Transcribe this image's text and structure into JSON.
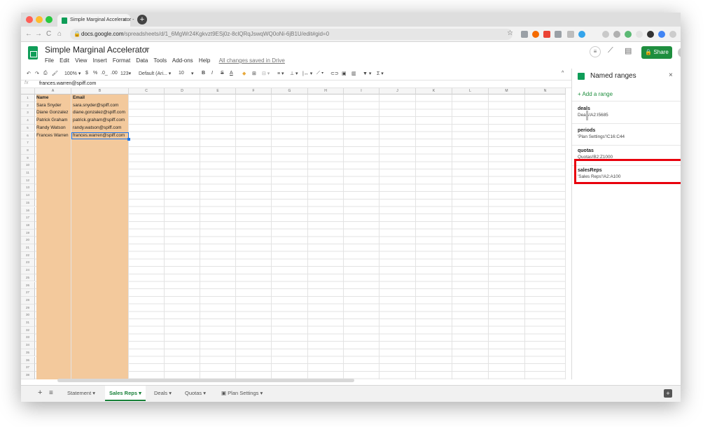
{
  "browser": {
    "tab_title": "Simple Marginal Accelerator -",
    "tab_close": "×",
    "new_tab": "+",
    "url_host": "docs.google.com",
    "url_rest": "/spreadsheets/d/1_6MgWr24Kgkvzt9ESj0z-8clQRqJswqWQ0oNi-6jB1U/edit#gid=0",
    "nav_back": "←",
    "nav_forward": "→",
    "nav_reload": "C",
    "nav_home": "⌂",
    "bookmark_star": "☆"
  },
  "doc": {
    "title": "Simple Marginal Accelerator",
    "star": "☆",
    "folder": "■",
    "menus": [
      "File",
      "Edit",
      "View",
      "Insert",
      "Format",
      "Data",
      "Tools",
      "Add-ons",
      "Help"
    ],
    "saved_status": "All changes saved in Drive",
    "share_label": "Share",
    "share_icon": "🔒"
  },
  "toolbar": {
    "undo": "↶",
    "redo": "↷",
    "print": "⎙",
    "paint": "🖌",
    "zoom": "100% ▾",
    "currency": "$",
    "percent": "%",
    "dec_less": ".0_",
    "dec_more": ".00",
    "format": "123▾",
    "font": "Default (Ari... ▾",
    "font_size": "10",
    "size_arrow": "▾",
    "bold": "B",
    "italic": "I",
    "strike": "S",
    "text_color": "A",
    "fill": "◆",
    "borders": "⊞",
    "merge": "⊟ ▾",
    "halign": "≡ ▾",
    "valign": "⊥ ▾",
    "wrap": "|↔ ▾",
    "rotate": "⟋ ▾",
    "link": "⊂⊃",
    "comment": "▣",
    "chart": "▥",
    "filter": "▼ ▾",
    "functions": "Σ ▾",
    "collapse": "^"
  },
  "formula_bar": {
    "fx": "fx",
    "value": "frances.warren@spiff.com"
  },
  "grid": {
    "columns": [
      "A",
      "B",
      "C",
      "D",
      "E",
      "F",
      "G",
      "H",
      "I",
      "J",
      "K",
      "L",
      "M",
      "N"
    ],
    "rows_count": 38,
    "header": [
      "Name",
      "Email"
    ],
    "data": [
      [
        "Sara Snyder",
        "sara.snyder@spiff.com"
      ],
      [
        "Diane Gonzalez",
        "diane.gonzalez@spiff.com"
      ],
      [
        "Patrick Graham",
        "patrick.graham@spiff.com"
      ],
      [
        "Randy Watson",
        "randy.watson@spiff.com"
      ],
      [
        "Frances Warren",
        "frances.warren@spiff.com"
      ]
    ],
    "fill_color": "#f3c99c",
    "selection_color": "#1a73e8"
  },
  "sidebar": {
    "title": "Named ranges",
    "close": "×",
    "add_label": "+ Add a range",
    "ranges": [
      {
        "name": "deals",
        "range": "Deals!A2:I5685"
      },
      {
        "name": "periods",
        "range": "'Plan Settings'!C16:C44"
      },
      {
        "name": "quotas",
        "range": "Quotas!B2:Z1000"
      },
      {
        "name": "salesReps",
        "range": "'Sales Reps'!A2:A100"
      }
    ],
    "highlight_color": "#e8000c"
  },
  "sheets": {
    "add": "+",
    "all": "≡",
    "tabs": [
      {
        "label": "Statement ▾",
        "active": false
      },
      {
        "label": "Sales Reps ▾",
        "active": true
      },
      {
        "label": "Deals ▾",
        "active": false
      },
      {
        "label": "Quotas ▾",
        "active": false
      },
      {
        "label": "Plan Settings ▾",
        "active": false
      }
    ],
    "explore": "+"
  }
}
